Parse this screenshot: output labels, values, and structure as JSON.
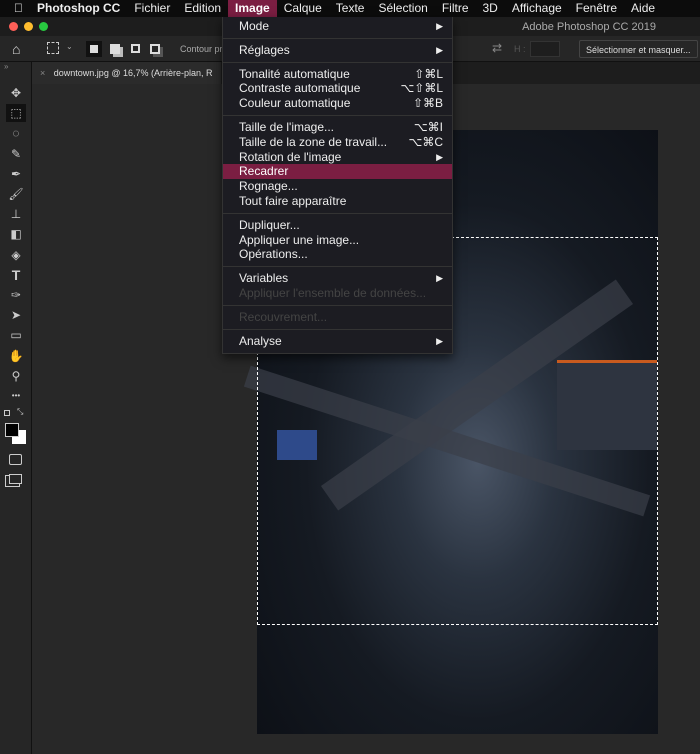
{
  "menubar": {
    "apple": "",
    "app": "Photoshop CC",
    "items": [
      "Fichier",
      "Edition",
      "Image",
      "Calque",
      "Texte",
      "Sélection",
      "Filtre",
      "3D",
      "Affichage",
      "Fenêtre",
      "Aide"
    ],
    "active": "Image"
  },
  "window": {
    "title": "Adobe Photoshop CC 2019"
  },
  "options": {
    "contour_label": "Contour pro",
    "h_label": "H :",
    "select_mask": "Sélectionner et masquer..."
  },
  "tab": {
    "close": "×",
    "title": "downtown.jpg @ 16,7% (Arrière-plan, R"
  },
  "menu": {
    "groups": [
      [
        {
          "label": "Mode",
          "submenu": true
        }
      ],
      [
        {
          "label": "Réglages",
          "submenu": true
        }
      ],
      [
        {
          "label": "Tonalité automatique",
          "shortcut": "⇧⌘L"
        },
        {
          "label": "Contraste automatique",
          "shortcut": "⌥⇧⌘L"
        },
        {
          "label": "Couleur automatique",
          "shortcut": "⇧⌘B"
        }
      ],
      [
        {
          "label": "Taille de l'image...",
          "shortcut": "⌥⌘I"
        },
        {
          "label": "Taille de la zone de travail...",
          "shortcut": "⌥⌘C"
        },
        {
          "label": "Rotation de l'image",
          "submenu": true
        },
        {
          "label": "Recadrer",
          "highlighted": true
        },
        {
          "label": "Rognage..."
        },
        {
          "label": "Tout faire apparaître"
        }
      ],
      [
        {
          "label": "Dupliquer..."
        },
        {
          "label": "Appliquer une image..."
        },
        {
          "label": "Opérations..."
        }
      ],
      [
        {
          "label": "Variables",
          "submenu": true
        },
        {
          "label": "Appliquer l'ensemble de données...",
          "disabled": true
        }
      ],
      [
        {
          "label": "Recouvrement...",
          "disabled": true
        }
      ],
      [
        {
          "label": "Analyse",
          "submenu": true
        }
      ]
    ]
  },
  "tools": [
    "move",
    "marquee",
    "lasso",
    "quick-select",
    "eyedropper",
    "brush",
    "stamp",
    "eraser",
    "paint-bucket",
    "type",
    "pen",
    "path-select",
    "rectangle",
    "hand",
    "zoom",
    "more"
  ],
  "colors": {
    "accent": "#7b1e42",
    "foreground": "#000000",
    "background": "#ffffff"
  }
}
